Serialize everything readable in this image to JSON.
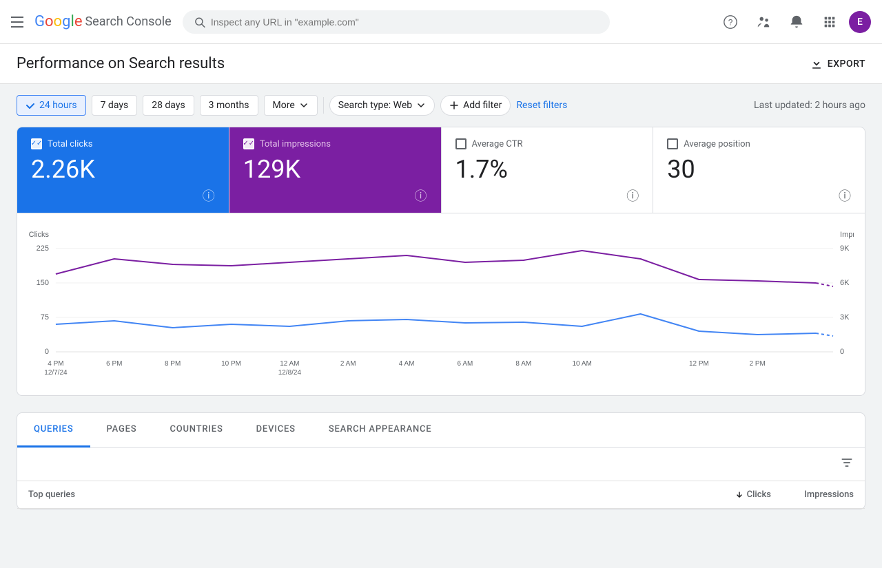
{
  "header": {
    "menu_icon": "hamburger-icon",
    "logo": {
      "text": "Google Search Console",
      "google_text": "Google",
      "product_text": " Search Console"
    },
    "search": {
      "placeholder": "Inspect any URL in \"example.com\""
    },
    "actions": {
      "help_label": "?",
      "training_label": "👤",
      "bell_label": "🔔",
      "grid_label": "⋮⋮⋮",
      "avatar_label": "E"
    }
  },
  "page": {
    "title": "Performance on Search results",
    "export_label": "EXPORT"
  },
  "filters": {
    "time_filters": [
      {
        "label": "24 hours",
        "active": true
      },
      {
        "label": "7 days",
        "active": false
      },
      {
        "label": "28 days",
        "active": false
      },
      {
        "label": "3 months",
        "active": false
      }
    ],
    "more_label": "More",
    "search_type_label": "Search type: Web",
    "add_filter_label": "Add filter",
    "reset_label": "Reset filters",
    "last_updated": "Last updated: 2 hours ago"
  },
  "metrics": [
    {
      "id": "total-clicks",
      "label": "Total clicks",
      "value": "2.26K",
      "active": true,
      "theme": "blue",
      "checked": true
    },
    {
      "id": "total-impressions",
      "label": "Total impressions",
      "value": "129K",
      "active": true,
      "theme": "purple",
      "checked": true
    },
    {
      "id": "average-ctr",
      "label": "Average CTR",
      "value": "1.7%",
      "active": false,
      "theme": "none",
      "checked": false
    },
    {
      "id": "average-position",
      "label": "Average position",
      "value": "30",
      "active": false,
      "theme": "none",
      "checked": false
    }
  ],
  "chart": {
    "y_axis_left": {
      "label": "Clicks",
      "ticks": [
        "225",
        "150",
        "75",
        "0"
      ]
    },
    "y_axis_right": {
      "label": "Impressions",
      "ticks": [
        "9K",
        "6K",
        "3K",
        "0"
      ]
    },
    "x_axis_labels": [
      {
        "line1": "4 PM",
        "line2": "12/7/24"
      },
      {
        "line1": "6 PM",
        "line2": ""
      },
      {
        "line1": "8 PM",
        "line2": ""
      },
      {
        "line1": "10 PM",
        "line2": ""
      },
      {
        "line1": "12 AM",
        "line2": "12/8/24"
      },
      {
        "line1": "2 AM",
        "line2": ""
      },
      {
        "line1": "4 AM",
        "line2": ""
      },
      {
        "line1": "6 AM",
        "line2": ""
      },
      {
        "line1": "8 AM",
        "line2": ""
      },
      {
        "line1": "10 AM",
        "line2": ""
      },
      {
        "line1": "12 PM",
        "line2": ""
      },
      {
        "line1": "2 PM",
        "line2": ""
      }
    ]
  },
  "tabs": {
    "items": [
      {
        "label": "QUERIES",
        "active": true
      },
      {
        "label": "PAGES",
        "active": false
      },
      {
        "label": "COUNTRIES",
        "active": false
      },
      {
        "label": "DEVICES",
        "active": false
      },
      {
        "label": "SEARCH APPEARANCE",
        "active": false
      }
    ],
    "table": {
      "col_main": "Top queries",
      "col_clicks": "Clicks",
      "col_impressions": "Impressions"
    }
  }
}
